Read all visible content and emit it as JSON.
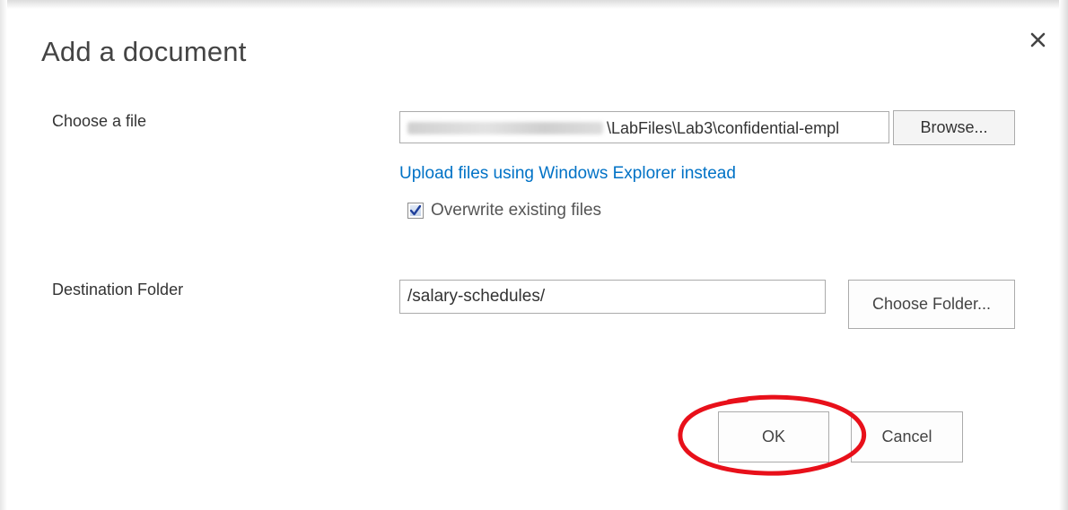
{
  "dialog": {
    "title": "Add a document",
    "close_icon": "close-icon"
  },
  "file": {
    "label": "Choose a file",
    "value_visible": "\\LabFiles\\Lab3\\confidential-empl",
    "browse_label": "Browse...",
    "upload_link": "Upload files using Windows Explorer instead",
    "overwrite_label": "Overwrite existing files",
    "overwrite_checked": true
  },
  "destination": {
    "label": "Destination Folder",
    "value": "/salary-schedules/",
    "choose_label": "Choose Folder..."
  },
  "actions": {
    "ok_label": "OK",
    "cancel_label": "Cancel"
  },
  "annotation": {
    "highlight_color": "#e8101a",
    "target": "ok-button"
  },
  "colors": {
    "link": "#0072c6",
    "checkbox_check": "#1f3f9a"
  }
}
